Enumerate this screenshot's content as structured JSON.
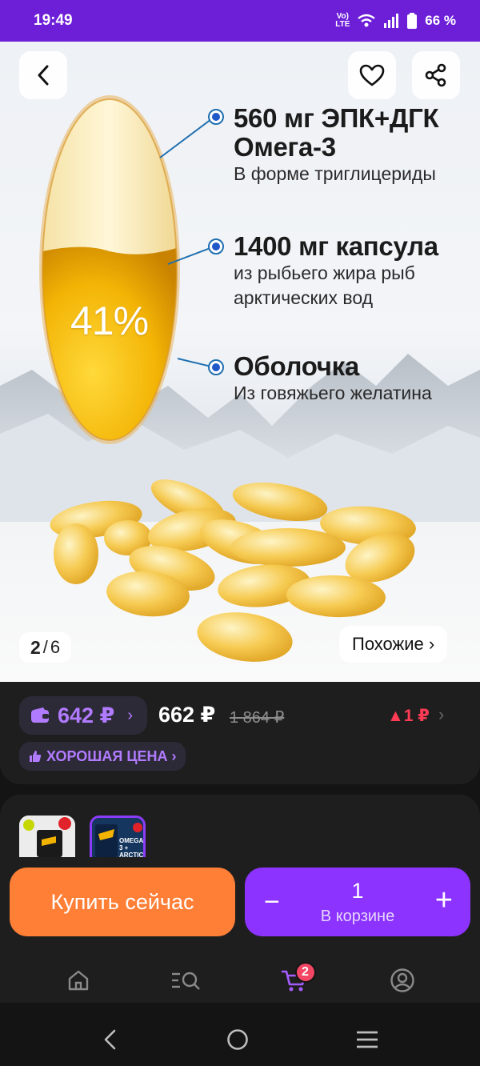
{
  "status": {
    "time": "19:49",
    "network": "Vo) LTE",
    "battery": "66 %"
  },
  "hero": {
    "annotations": [
      {
        "title": "560 мг ЭПК+ДГК",
        "title2": "Омега-3",
        "sub": "В форме триглицериды"
      },
      {
        "title": "1400 мг капсула",
        "sub": "из рыбьего жира рыб",
        "sub2": "арктических вод"
      },
      {
        "title": "Оболочка",
        "sub": "Из говяжьего желатина"
      }
    ],
    "percent": "41%",
    "counter_current": "2",
    "counter_sep": "/",
    "counter_total": "6",
    "similar_label": "Похожие ›"
  },
  "price": {
    "wallet_price": "642 ₽",
    "wallet_chevron": "›",
    "price": "662 ₽",
    "old_price": "1 864 ₽",
    "delta": "▲1 ₽",
    "chevron": "›",
    "badge": "ХОРОШАЯ ЦЕНА ›"
  },
  "thumbs": [
    {
      "text": ""
    },
    {
      "text": "OMEGA-3 + ARCTIC"
    }
  ],
  "actions": {
    "buy_label": "Купить сейчас",
    "minus": "−",
    "qty": "1",
    "in_cart": "В корзине",
    "plus": "+"
  },
  "tabs": {
    "cart_badge": "2"
  },
  "colors": {
    "status_bar": "#6d1fd8",
    "buy": "#ff7f36",
    "cart": "#8c33ff",
    "accent": "#b17bff",
    "price_up": "#ff3b55"
  }
}
